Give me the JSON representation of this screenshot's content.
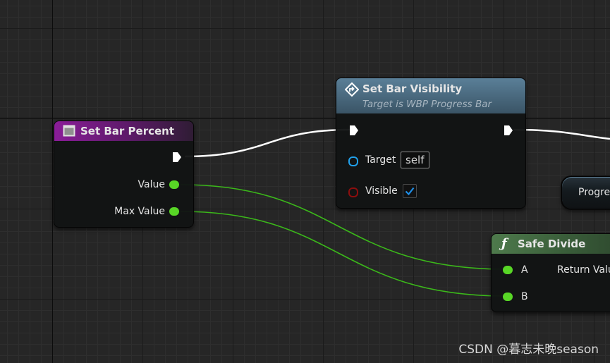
{
  "colors": {
    "exec_wire": "#ffffff",
    "float_wire": "#3bb81a",
    "float_pin": "#58d626",
    "object_pin": "#21a0ea",
    "bool_pin": "#8c0e0e",
    "check": "#1e8fe8"
  },
  "set_bar_percent": {
    "icon": "event-box-icon",
    "title": "Set Bar Percent",
    "pins": {
      "value": "Value",
      "max_value": "Max Value"
    }
  },
  "set_bar_visibility": {
    "icon": "function-diamond-icon",
    "title": "Set Bar Visibility",
    "subtitle": "Target is WBP Progress Bar",
    "pins": {
      "target": "Target",
      "target_value": "self",
      "visible": "Visible"
    },
    "visible_checked": true
  },
  "progress_node": {
    "title": "Progre"
  },
  "safe_divide": {
    "icon": "function-f-icon",
    "title": "Safe Divide",
    "pins": {
      "a": "A",
      "b": "B",
      "return_value": "Return Valu"
    }
  },
  "watermark": "CSDN @暮志未晚season"
}
